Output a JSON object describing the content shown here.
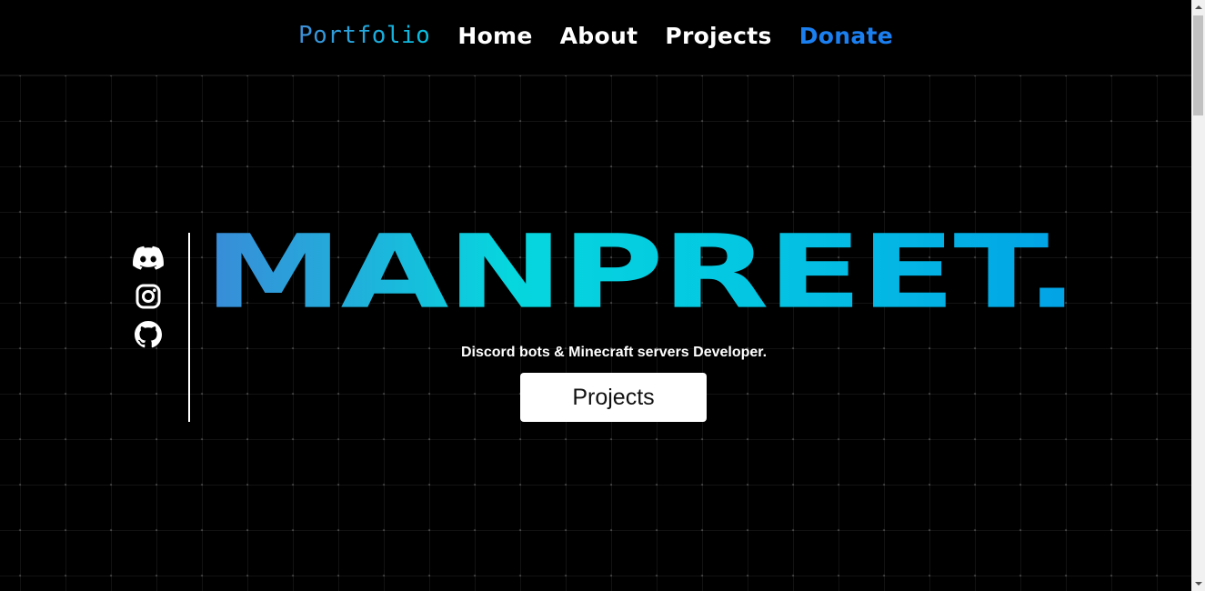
{
  "nav": {
    "brand": "Portfolio",
    "links": [
      {
        "label": "Home"
      },
      {
        "label": "About"
      },
      {
        "label": "Projects"
      },
      {
        "label": "Donate"
      }
    ]
  },
  "social": {
    "icons": [
      "discord-icon",
      "instagram-icon",
      "github-icon"
    ]
  },
  "hero": {
    "title": "MANPREET.",
    "subtitle": "Discord bots & Minecraft servers Developer.",
    "cta_label": "Projects"
  },
  "colors": {
    "background": "#000000",
    "brand_gradient_start": "#3a8ad8",
    "brand_gradient_mid": "#06d6de",
    "brand_gradient_end": "#02a2e6",
    "donate": "#1b7ff0",
    "text": "#ffffff"
  }
}
